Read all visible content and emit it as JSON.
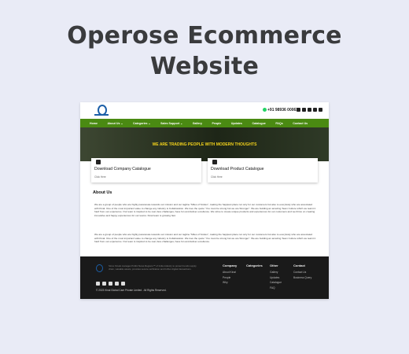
{
  "card": {
    "title_line1": "Operose Ecommerce",
    "title_line2": "Website"
  },
  "site": {
    "phone": "+91 98936 00063",
    "nav": [
      "Home",
      "About Us ⌄",
      "Categories ⌄",
      "Sales Support ⌄",
      "Gallery",
      "People",
      "Updates",
      "Catalogue",
      "FAQs",
      "Contact Us"
    ],
    "hero_text": "WE ARE TRADING PEOPLE WITH MODERN THOUGHTS",
    "catalogues": [
      {
        "title": "Download Company Catalogue",
        "link": "Click Here"
      },
      {
        "title": "Download Product Catalogue",
        "link": "Click Here"
      }
    ],
    "about": {
      "heading": "About Us",
      "para1": "We are a group of people who are highly passionate towards our mission and our tagline \"Miles of Smiles\", making the happiest place not only for our customers but also to everybody who are associated with Kinal. One of the most important value to change any industry is Collaboration. We love the quote \"You must be strong but we are Stronger\". We are building an amazing Team Culture which we learnt it hard from our experience. Our team is inspired to be real, face challenges, have fun and deliver excellence. We strive to create unique products and experiences for our customers and we thrive on creating innovative and happy experiences for our teams. Kinal team is growing fast.",
      "para2": "We are a group of people who are highly passionate towards our mission and our tagline \"Miles of Smiles\", making the happiest place not only for our customers but also to everybody who are associated with Kinal. One of the most important value to change any industry is Collaboration. We love the quote \"You must be strong but we are Stronger\". We are building an amazing Team Culture which we learnt it hard from our experience. Our team is inspired to be real, face challenges, have fun and deliver excellence."
    },
    "footer": {
      "description": "Since Kinals manages Public News Regions™ of India industry to protect trends supply chain, valuable assets, provides secure verification and further digital transactions.",
      "copyright": "© 2023 Kinal Global Care Private Limited . All Rights Reserved.",
      "company": {
        "heading": "Company",
        "links": [
          "About Kinal",
          "People",
          "Why"
        ]
      },
      "categories": {
        "heading": "Categories",
        "links": []
      },
      "other": {
        "heading": "Other",
        "links": [
          "Gallery",
          "Updates",
          "Catalogue",
          "FAQ"
        ]
      },
      "contact": {
        "heading": "Contact",
        "links": [
          "Contact Us",
          "Business Query"
        ]
      }
    }
  },
  "colors": {
    "background": "#e9ebf6",
    "nav_green": "#4a8a12",
    "hero_text_yellow": "#f2d21b",
    "footer_dark": "#1a1a1a",
    "logo_blue": "#1c5fa8"
  },
  "icons": [
    "whatsapp-icon",
    "facebook-icon",
    "twitter-icon",
    "linkedin-icon",
    "youtube-icon",
    "instagram-icon",
    "download-icon"
  ]
}
